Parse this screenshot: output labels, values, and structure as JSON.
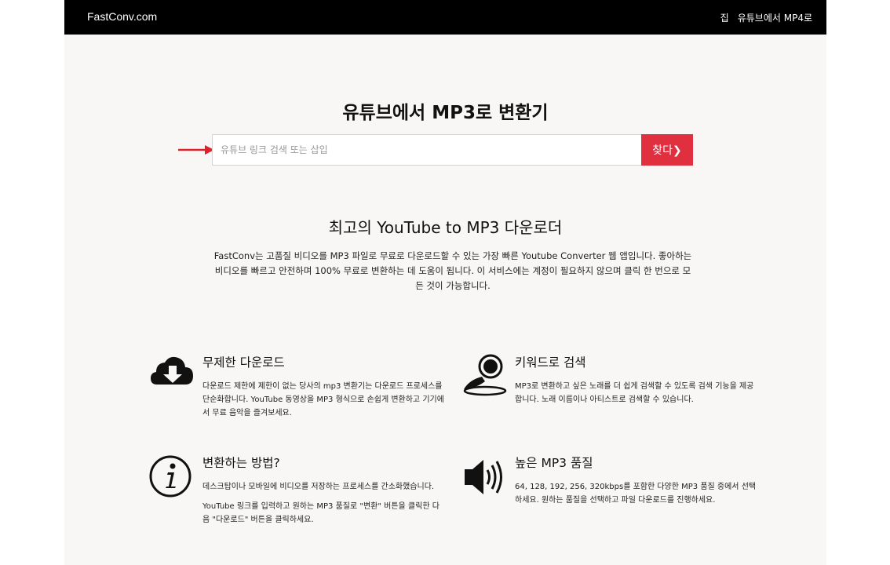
{
  "header": {
    "brand": "FastConv.com",
    "nav": [
      "집",
      "유튜브에서 MP4로"
    ]
  },
  "hero": {
    "title": "유튜브에서 MP3로 변환기",
    "search_placeholder": "유튜브 링크 검색 또는 삽입",
    "search_button": "찾다❯"
  },
  "about": {
    "title": "최고의 YouTube to MP3 다운로더",
    "text": "FastConv는 고품질 비디오를 MP3 파일로 무료로 다운로드할 수 있는 가장 빠른 Youtube Converter 웹 앱입니다. 좋아하는 비디오를 빠르고 안전하며 100% 무료로 변환하는 데 도움이 됩니다. 이 서비스에는 계정이 필요하지 않으며 클릭 한 번으로 모든 것이 가능합니다."
  },
  "features": [
    {
      "icon": "cloud-download-icon",
      "title": "무제한 다운로드",
      "text": [
        "다운로드 제한에 제한이 없는 당사의 mp3 변환기는 다운로드 프로세스를 단순화합니다. YouTube 동영상을 MP3 형식으로 손쉽게 변환하고 기기에서 무료 음악을 즐겨보세요."
      ]
    },
    {
      "icon": "search-person-icon",
      "title": "키워드로 검색",
      "text": [
        "MP3로 변환하고 싶은 노래를 더 쉽게 검색할 수 있도록 검색 기능을 제공합니다. 노래 이름이나 아티스트로 검색할 수 있습니다."
      ]
    },
    {
      "icon": "info-icon",
      "title": "변환하는 방법?",
      "text": [
        "데스크탑이나 모바일에 비디오를 저장하는 프로세스를 간소화했습니다.",
        "YouTube 링크를 입력하고 원하는 MP3 품질로 \"변환\" 버튼을 클릭한 다음 \"다운로드\" 버튼을 클릭하세요."
      ]
    },
    {
      "icon": "speaker-icon",
      "title": "높은 MP3 품질",
      "text": [
        "64, 128, 192, 256, 320kbps를 포함한 다양한 MP3 품질 중에서 선택하세요. 원하는 품질을 선택하고 파일 다운로드를 진행하세요."
      ]
    }
  ],
  "colors": {
    "accent": "#e0303f",
    "header_bg": "#000000",
    "page_bg": "#f8f7f5"
  }
}
